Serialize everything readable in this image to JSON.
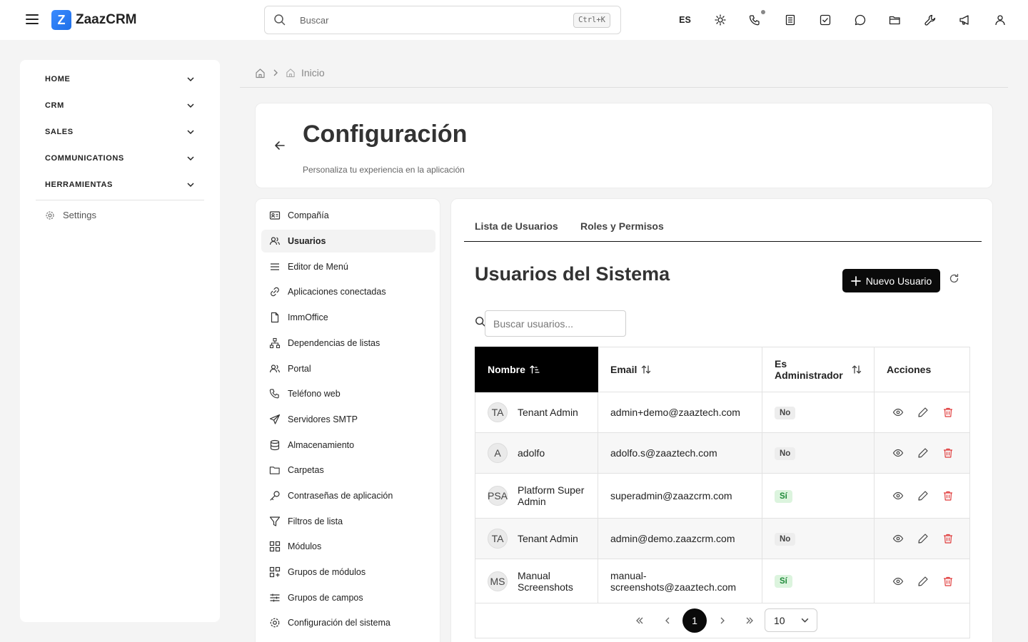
{
  "app": {
    "logo_letter": "Z",
    "name": "ZaazCRM"
  },
  "search": {
    "placeholder": "Buscar",
    "shortcut": "Ctrl+K"
  },
  "topbar": {
    "language": "ES",
    "icons": [
      "sun-icon",
      "phone-icon",
      "document-icon",
      "task-icon",
      "chat-icon",
      "folder-icon",
      "wrench-icon",
      "megaphone-icon",
      "user-icon"
    ]
  },
  "nav": {
    "groups": [
      "HOME",
      "CRM",
      "SALES",
      "COMMUNICATIONS",
      "HERRAMIENTAS"
    ],
    "settings_label": "Settings"
  },
  "breadcrumb": {
    "current": "Inicio"
  },
  "header": {
    "title": "Configuración",
    "subtitle": "Personaliza tu experiencia en la aplicación"
  },
  "settings_menu": {
    "active": "Usuarios",
    "items": [
      "Compañía",
      "Usuarios",
      "Editor de Menú",
      "Aplicaciones conectadas",
      "ImmOffice",
      "Dependencias de listas",
      "Portal",
      "Teléfono web",
      "Servidores SMTP",
      "Almacenamiento",
      "Carpetas",
      "Contraseñas de aplicación",
      "Filtros de lista",
      "Módulos",
      "Grupos de módulos",
      "Grupos de campos",
      "Configuración del sistema"
    ]
  },
  "main": {
    "tabs": [
      "Lista de Usuarios",
      "Roles y Permisos"
    ],
    "title": "Usuarios del Sistema",
    "new_button": "Nuevo Usuario",
    "search_placeholder": "Buscar usuarios...",
    "columns": [
      "Nombre",
      "Email",
      "Es Administrador",
      "Acciones"
    ],
    "rows": [
      {
        "initials": "TA",
        "name": "Tenant Admin",
        "email": "admin+demo@zaaztech.com",
        "admin": "No"
      },
      {
        "initials": "A",
        "name": "adolfo",
        "email": "adolfo.s@zaaztech.com",
        "admin": "No"
      },
      {
        "initials": "PSA",
        "name": "Platform Super Admin",
        "email": "superadmin@zaazcrm.com",
        "admin": "Sí"
      },
      {
        "initials": "TA",
        "name": "Tenant Admin",
        "email": "admin@demo.zaazcrm.com",
        "admin": "No"
      },
      {
        "initials": "MS",
        "name": "Manual Screenshots",
        "email": "manual-screenshots@zaaztech.com",
        "admin": "Sí"
      }
    ],
    "pagination": {
      "current_page": "1",
      "page_size": "10"
    }
  },
  "colors": {
    "accent": "#0a0a0a",
    "logo": "#2f7ff5",
    "danger": "#e03b3b",
    "success_badge": "#1f8a3a"
  }
}
